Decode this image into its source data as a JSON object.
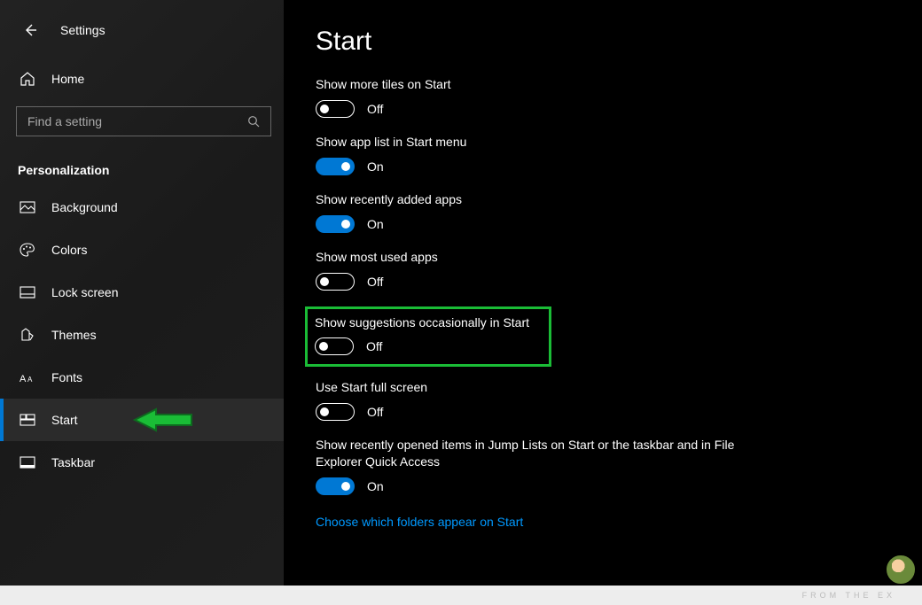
{
  "header": {
    "app_name": "Settings"
  },
  "sidebar": {
    "home": "Home",
    "search_placeholder": "Find a setting",
    "category": "Personalization",
    "items": [
      {
        "label": "Background"
      },
      {
        "label": "Colors"
      },
      {
        "label": "Lock screen"
      },
      {
        "label": "Themes"
      },
      {
        "label": "Fonts"
      },
      {
        "label": "Start"
      },
      {
        "label": "Taskbar"
      }
    ]
  },
  "main": {
    "title": "Start",
    "settings": [
      {
        "label": "Show more tiles on Start",
        "state": "Off",
        "on": false
      },
      {
        "label": "Show app list in Start menu",
        "state": "On",
        "on": true
      },
      {
        "label": "Show recently added apps",
        "state": "On",
        "on": true
      },
      {
        "label": "Show most used apps",
        "state": "Off",
        "on": false
      },
      {
        "label": "Show suggestions occasionally in Start",
        "state": "Off",
        "on": false
      },
      {
        "label": "Use Start full screen",
        "state": "Off",
        "on": false
      },
      {
        "label": "Show recently opened items in Jump Lists on Start or the taskbar and in File Explorer Quick Access",
        "state": "On",
        "on": true
      }
    ],
    "link": "Choose which folders appear on Start"
  },
  "footer": {
    "watermark": "FROM THE EX"
  }
}
